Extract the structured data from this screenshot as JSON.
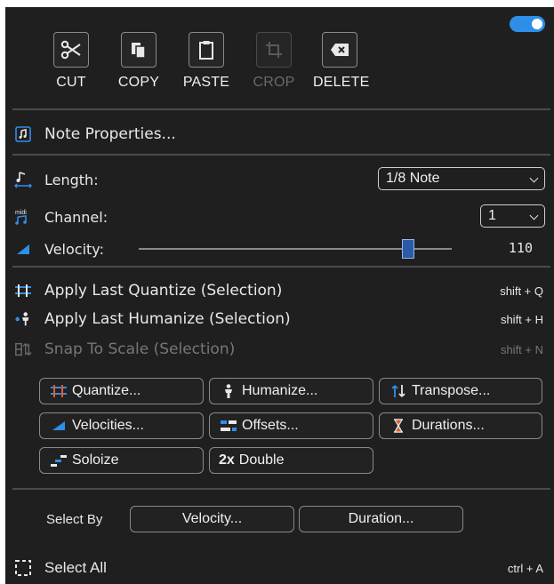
{
  "toggle": {
    "state": "on",
    "color": "#2f8fe8"
  },
  "toolbar": [
    {
      "icon": "scissors-icon",
      "label": "CUT",
      "enabled": true
    },
    {
      "icon": "copy-icon",
      "label": "COPY",
      "enabled": true
    },
    {
      "icon": "clipboard-icon",
      "label": "PASTE",
      "enabled": true
    },
    {
      "icon": "crop-icon",
      "label": "CROP",
      "enabled": false
    },
    {
      "icon": "backspace-icon",
      "label": "DELETE",
      "enabled": true
    }
  ],
  "note_properties": {
    "label": "Note Properties...",
    "icon": "note-box-icon"
  },
  "length": {
    "label": "Length:",
    "value": "1/8 Note",
    "icon": "note-length-icon"
  },
  "channel": {
    "label": "Channel:",
    "value": "1",
    "icon": "midi-icon"
  },
  "velocity": {
    "label": "Velocity:",
    "value": "110",
    "level": 0.86,
    "icon": "velocity-icon"
  },
  "actions": [
    {
      "label": "Apply Last Quantize (Selection)",
      "shortcut": "shift + Q",
      "icon": "quantize-icon",
      "enabled": true
    },
    {
      "label": "Apply Last Humanize (Selection)",
      "shortcut": "shift + H",
      "icon": "humanize-icon",
      "enabled": true
    },
    {
      "label": "Snap To Scale (Selection)",
      "shortcut": "shift + N",
      "icon": "snap-scale-icon",
      "enabled": false
    }
  ],
  "tools": [
    {
      "label": "Quantize...",
      "icon": "quantize-icon"
    },
    {
      "label": "Humanize...",
      "icon": "person-icon"
    },
    {
      "label": "Transpose...",
      "icon": "transpose-icon"
    },
    {
      "label": "Velocities...",
      "icon": "velocity-icon"
    },
    {
      "label": "Offsets...",
      "icon": "offsets-icon"
    },
    {
      "label": "Durations...",
      "icon": "hourglass-icon"
    },
    {
      "label": "Soloize",
      "icon": "soloize-icon"
    },
    {
      "label": "Double",
      "icon_text": "2x"
    }
  ],
  "select_by": {
    "label": "Select By",
    "velocity_label": "Velocity...",
    "duration_label": "Duration..."
  },
  "select_all": {
    "label": "Select All",
    "shortcut": "ctrl + A",
    "icon": "selection-box-icon"
  },
  "colors": {
    "accent": "#2f8fe8",
    "quantize": "#e85a2a",
    "panel": "#1f1f1f"
  }
}
